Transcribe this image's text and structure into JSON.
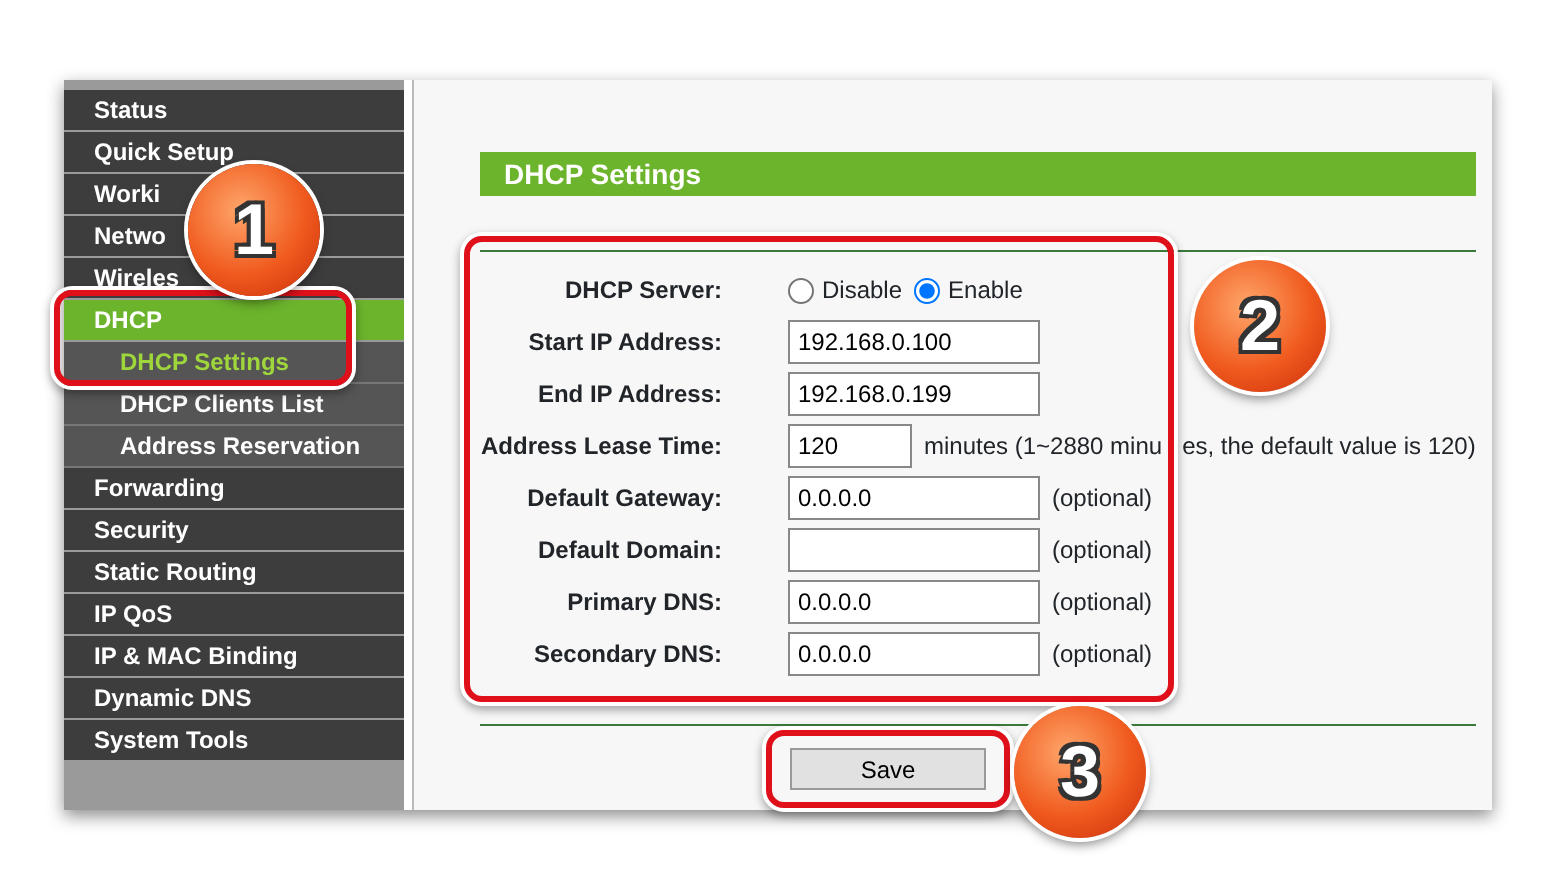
{
  "sidebar": {
    "items": [
      {
        "label": "Status",
        "selected": false
      },
      {
        "label": "Quick Setup",
        "selected": false
      },
      {
        "label": "Worki",
        "selected": false
      },
      {
        "label": "Netwo",
        "selected": false
      },
      {
        "label": "Wireles",
        "selected": false
      },
      {
        "label": "DHCP",
        "selected": true,
        "children": [
          {
            "label": "DHCP Settings",
            "selected": true
          },
          {
            "label": "DHCP Clients List",
            "selected": false
          },
          {
            "label": "Address Reservation",
            "selected": false
          }
        ]
      },
      {
        "label": "Forwarding",
        "selected": false
      },
      {
        "label": "Security",
        "selected": false
      },
      {
        "label": "Static Routing",
        "selected": false
      },
      {
        "label": "IP QoS",
        "selected": false
      },
      {
        "label": "IP & MAC Binding",
        "selected": false
      },
      {
        "label": "Dynamic DNS",
        "selected": false
      },
      {
        "label": "System Tools",
        "selected": false
      }
    ]
  },
  "section_title": "DHCP Settings",
  "form": [
    {
      "kind": "radio",
      "label": "DHCP Server:",
      "options": [
        {
          "label": "Disable",
          "selected": false
        },
        {
          "label": "Enable",
          "selected": true
        }
      ]
    },
    {
      "kind": "text",
      "label": "Start IP Address:",
      "value": "192.168.0.100"
    },
    {
      "kind": "text",
      "label": "End IP Address:",
      "value": "192.168.0.199"
    },
    {
      "kind": "short",
      "label": "Address Lease Time:",
      "value": "120",
      "note": "minutes (1~2880 minu",
      "note_after": "es, the default value is 120)"
    },
    {
      "kind": "text",
      "label": "Default Gateway:",
      "value": "0.0.0.0",
      "note": "(optional)"
    },
    {
      "kind": "text",
      "label": "Default Domain:",
      "note": "(optional)"
    },
    {
      "kind": "text",
      "label": "Primary DNS:",
      "value": "0.0.0.0",
      "note": "(optional)"
    },
    {
      "kind": "text",
      "label": "Secondary DNS:",
      "value": "0.0.0.0",
      "note": "(optional)"
    }
  ],
  "save_button": "Save",
  "callouts": [
    {
      "label": "1"
    },
    {
      "label": "2"
    },
    {
      "label": "3"
    }
  ]
}
